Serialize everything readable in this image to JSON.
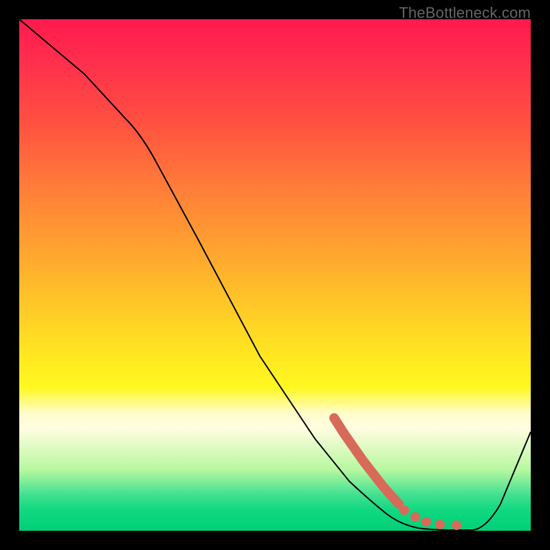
{
  "watermark": "TheBottleneck.com",
  "chart_data": {
    "type": "line",
    "title": "",
    "xlabel": "",
    "ylabel": "",
    "xlim": [
      0,
      100
    ],
    "ylim": [
      0,
      100
    ],
    "grid": false,
    "legend": false,
    "series": [
      {
        "name": "bottleneck-curve",
        "x": [
          0,
          10,
          18,
          24,
          30,
          40,
          50,
          60,
          66,
          70,
          74,
          78,
          82,
          86,
          90,
          95,
          100
        ],
        "y": [
          100,
          90,
          82,
          76,
          70,
          55,
          40,
          25,
          17,
          11,
          6,
          3,
          1,
          0,
          0,
          8,
          20
        ],
        "color": "#000000"
      }
    ],
    "highlight": {
      "name": "highlight-dots",
      "color": "#d86a5a",
      "points_x": [
        62,
        63,
        64,
        65,
        66,
        67,
        68,
        70,
        72,
        75,
        77,
        80,
        83,
        86
      ],
      "points_y": [
        21,
        19,
        17.5,
        16,
        14.5,
        13,
        11.5,
        9,
        7,
        5,
        3.8,
        2.5,
        1.8,
        1.5
      ]
    },
    "background_gradient": {
      "stops": [
        {
          "pos": 0.0,
          "color": "#ff1a4d"
        },
        {
          "pos": 0.5,
          "color": "#ffc828"
        },
        {
          "pos": 0.78,
          "color": "#fffccc"
        },
        {
          "pos": 1.0,
          "color": "#00d078"
        }
      ]
    }
  }
}
